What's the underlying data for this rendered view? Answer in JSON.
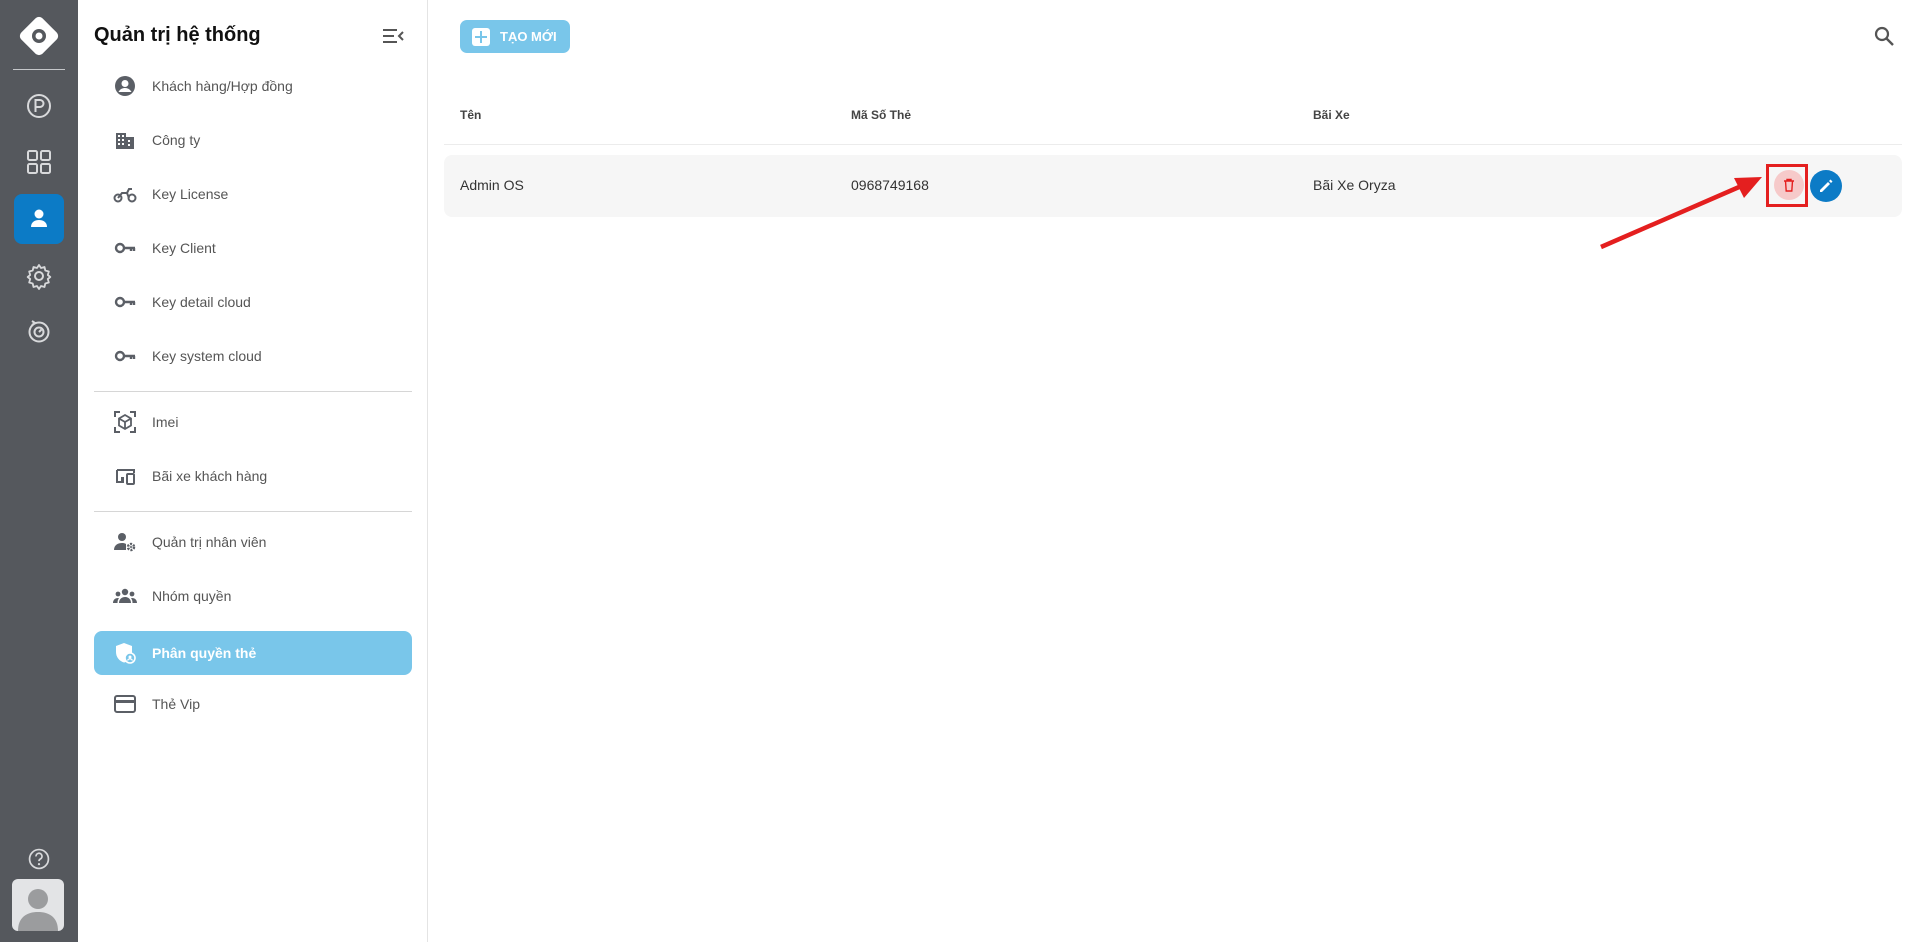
{
  "sidebar": {
    "title": "Quản trị hệ thống",
    "groups": [
      [
        {
          "label": "Khách hàng/Hợp đồng",
          "icon": "account-circle-icon"
        },
        {
          "label": "Công ty",
          "icon": "building-icon"
        },
        {
          "label": "Key License",
          "icon": "motorbike-icon"
        },
        {
          "label": "Key Client",
          "icon": "key-icon"
        },
        {
          "label": "Key detail cloud",
          "icon": "key-icon"
        },
        {
          "label": "Key system cloud",
          "icon": "key-icon"
        }
      ],
      [
        {
          "label": "Imei",
          "icon": "scan-cube-icon"
        },
        {
          "label": "Bãi xe khách hàng",
          "icon": "devices-icon"
        }
      ],
      [
        {
          "label": "Quản trị nhân viên",
          "icon": "user-gear-icon"
        },
        {
          "label": "Nhóm quyền",
          "icon": "group-icon"
        },
        {
          "label": "Phân quyền thẻ",
          "icon": "shield-user-icon",
          "active": true
        },
        {
          "label": "Thẻ Vip",
          "icon": "credit-card-icon"
        }
      ]
    ]
  },
  "rail": {
    "items": [
      "parking-icon",
      "grid-icon",
      "user-icon",
      "gear-icon",
      "history-icon"
    ],
    "active": "user-icon",
    "bottom": [
      "help-icon",
      "avatar"
    ]
  },
  "toolbar": {
    "create_label": "TẠO MỚI"
  },
  "table": {
    "columns": [
      "Tên",
      "Mã Số Thẻ",
      "Bãi Xe"
    ],
    "rows": [
      {
        "name": "Admin OS",
        "card_number": "0968749168",
        "parking_lot": "Bãi Xe Oryza"
      }
    ]
  },
  "colors": {
    "rail_bg": "#55585d",
    "accent": "#0c7bc6",
    "active_menu": "#79c6ea",
    "delete": "#e41f1f"
  }
}
